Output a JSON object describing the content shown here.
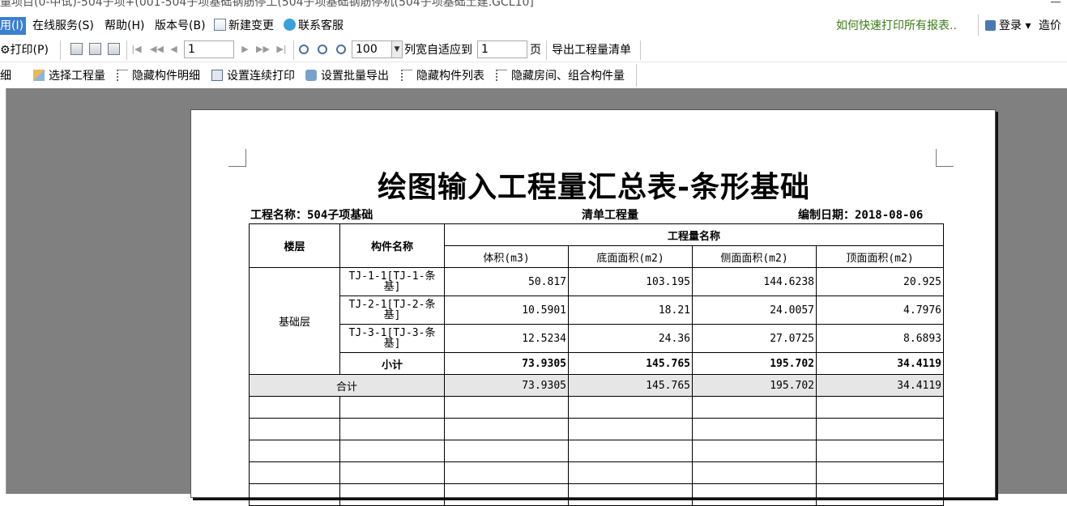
{
  "titlebar": {
    "text": "量项目(0-中试)-504子项+(001-504子项基础钢筋停工(504子项基础钢筋停机(504子项基础土建.GCL10]"
  },
  "menu": {
    "items": [
      {
        "label": "用(I)"
      },
      {
        "label": "在线服务(S)"
      },
      {
        "label": "帮助(H)"
      },
      {
        "label": "版本号(B)"
      },
      {
        "label": "新建变更"
      },
      {
        "label": "联系客服"
      }
    ],
    "quick_tip": "如何快速打印所有报表..",
    "login": "登录",
    "zaojia": "造价"
  },
  "toolbar1": {
    "print": "打印(P)",
    "page_input": "1",
    "zoom_value": "100",
    "fit_label": "列宽自适应到",
    "fit_pages": "1",
    "page_unit": "页",
    "export_bill": "导出工程量清单"
  },
  "toolbar2": {
    "items": [
      {
        "label": "细"
      },
      {
        "label": "选择工程量"
      },
      {
        "label": "隐藏构件明细"
      },
      {
        "label": "设置连续打印"
      },
      {
        "label": "设置批量导出"
      },
      {
        "label": "隐藏构件列表"
      },
      {
        "label": "隐藏房间、组合构件量"
      }
    ]
  },
  "report": {
    "title": "绘图输入工程量汇总表-条形基础",
    "project": "工程名称：504子项基础",
    "category": "清单工程量",
    "date": "编制日期：2018-08-06",
    "headers": {
      "floor": "楼层",
      "component": "构件名称",
      "group": "工程量名称",
      "cols": [
        "体积(m3)",
        "底面面积(m2)",
        "侧面面积(m2)",
        "顶面面积(m2)"
      ]
    },
    "floor_name": "基础层",
    "rows": [
      {
        "name": "TJ-1-1[TJ-1-条基]",
        "v": [
          "50.817",
          "103.195",
          "144.6238",
          "20.925"
        ]
      },
      {
        "name": "TJ-2-1[TJ-2-条基]",
        "v": [
          "10.5901",
          "18.21",
          "24.0057",
          "4.7976"
        ]
      },
      {
        "name": "TJ-3-1[TJ-3-条基]",
        "v": [
          "12.5234",
          "24.36",
          "27.0725",
          "8.6893"
        ]
      }
    ],
    "subtotal": {
      "label": "小计",
      "v": [
        "73.9305",
        "145.765",
        "195.702",
        "34.4119"
      ]
    },
    "total": {
      "label": "合计",
      "v": [
        "73.9305",
        "145.765",
        "195.702",
        "34.4119"
      ]
    }
  }
}
